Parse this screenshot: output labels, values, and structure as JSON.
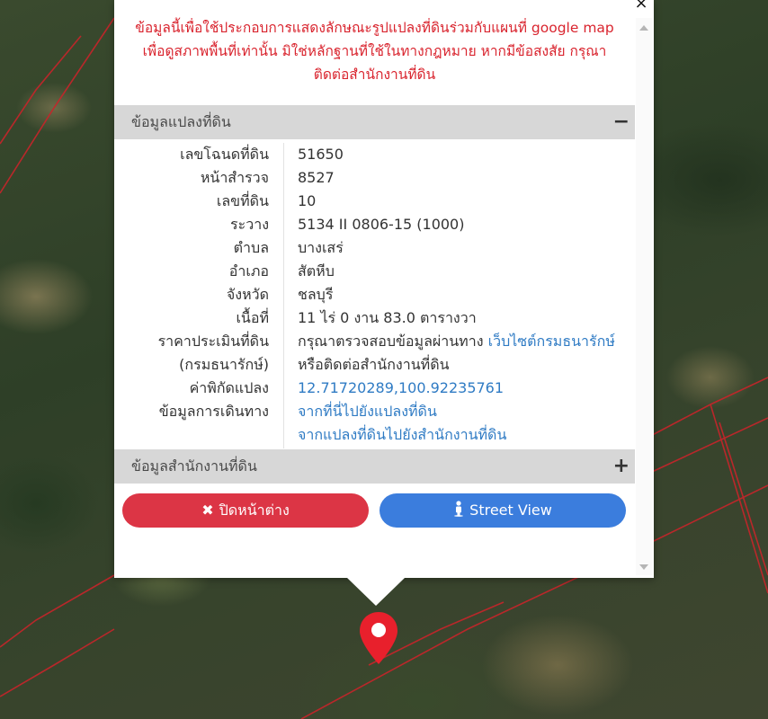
{
  "popup": {
    "close_glyph": "×",
    "disclaimer": "ข้อมูลนี้เพื่อใช้ประกอบการแสดงลักษณะรูปแปลงที่ดินร่วมกับแผนที่ google map เพื่อดูสภาพพื้นที่เท่านั้น มิใช่หลักฐานที่ใช้ในทางกฎหมาย หากมีข้อสงสัย กรุณาติดต่อสำนักงานที่ดิน",
    "disclaimer_lines": [
      "ข้อมูลนี้เพื่อใช้ประกอบการแสดงลักษณะรูปแปลงที่ดินร่วมกับแผนที่ google map",
      "เพื่อดูสภาพพื้นที่เท่านั้น มิใช่หลักฐานที่ใช้ในทางกฎหมาย หากมีข้อสงสัย กรุณา",
      "ติดต่อสำนักงานที่ดิน"
    ],
    "section1": {
      "title": "ข้อมูลแปลงที่ดิน",
      "toggle": "−"
    },
    "section2": {
      "title": "ข้อมูลสำนักงานที่ดิน",
      "toggle": "+"
    },
    "rows": [
      {
        "label": "เลขโฉนดที่ดิน",
        "value": "51650"
      },
      {
        "label": "หน้าสำรวจ",
        "value": "8527"
      },
      {
        "label": "เลขที่ดิน",
        "value": "10"
      },
      {
        "label": "ระวาง",
        "value": "5134 II 0806-15 (1000)"
      },
      {
        "label": "ตำบล",
        "value": "บางเสร่"
      },
      {
        "label": "อำเภอ",
        "value": "สัตหีบ"
      },
      {
        "label": "จังหวัด",
        "value": "ชลบุรี"
      },
      {
        "label": "เนื้อที่",
        "value": "11 ไร่ 0 งาน 83.0 ตารางวา"
      },
      {
        "label": "ราคาประเมินที่ดิน",
        "value": "กรุณาตรวจสอบข้อมูลผ่านทาง ",
        "link": "เว็บไซต์กรมธนารักษ์"
      },
      {
        "label": "(กรมธนารักษ์)",
        "value": "หรือติดต่อสำนักงานที่ดิน"
      },
      {
        "label": "ค่าพิกัดแปลง",
        "link": "12.71720289,100.92235761"
      },
      {
        "label": "ข้อมูลการเดินทาง",
        "link": "จากที่นี่ไปยังแปลงที่ดิน"
      },
      {
        "label": "",
        "link": "จากแปลงที่ดินไปยังสำนักงานที่ดิน"
      }
    ],
    "buttons": {
      "close_label": "ปิดหน้าต่าง",
      "street_label": "Street View"
    },
    "colors": {
      "disclaimer": "#d9242e",
      "close_button": "#dc3545",
      "street_button": "#3b7ddd",
      "link": "#2f7bc4",
      "pin": "#e8202c"
    }
  }
}
